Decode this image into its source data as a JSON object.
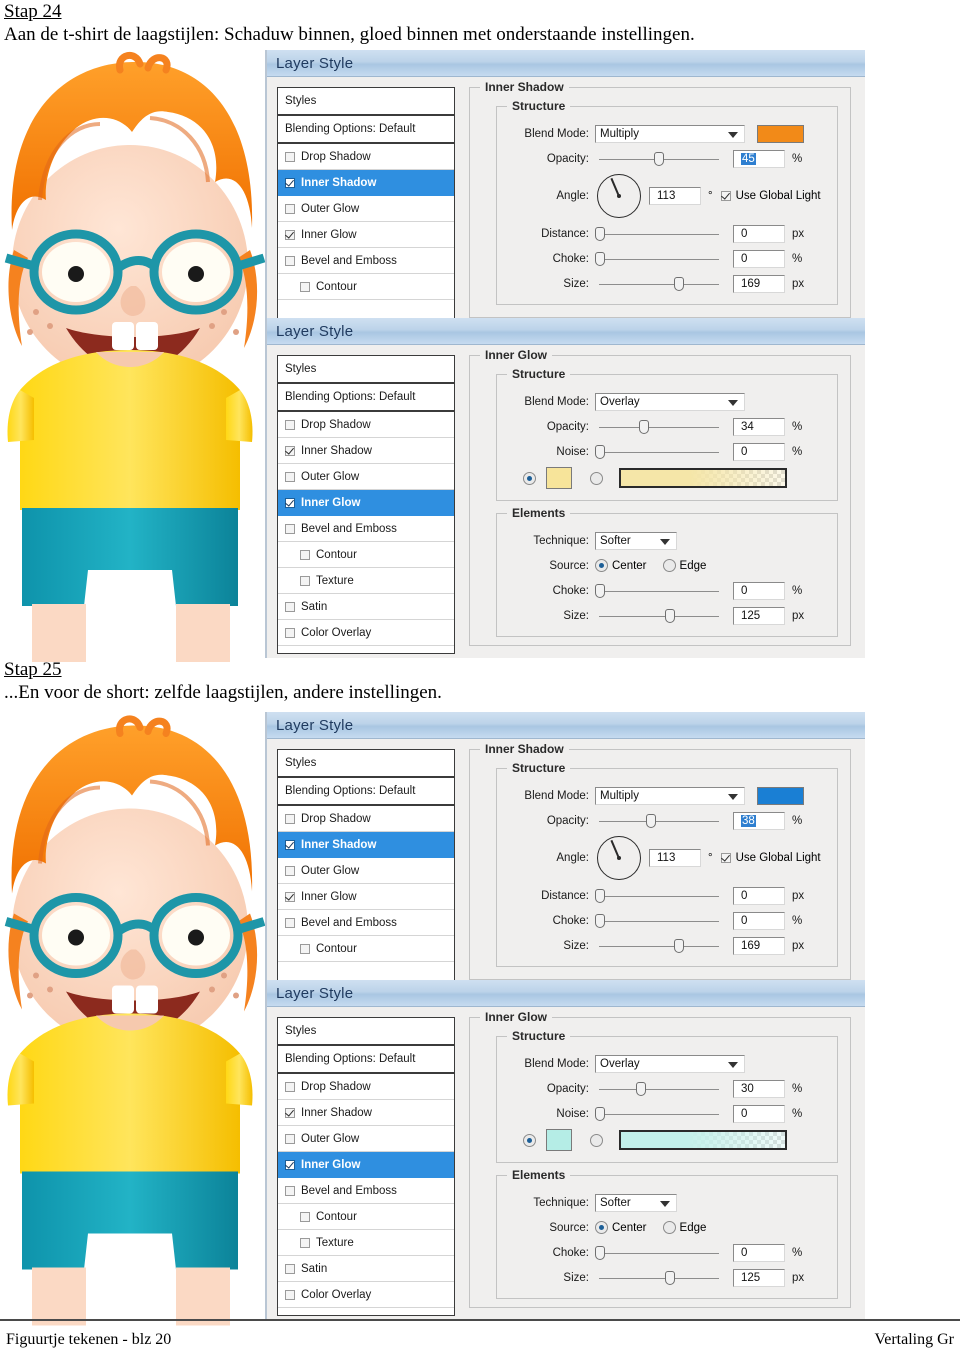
{
  "document": {
    "steps": [
      {
        "heading": "Stap 24",
        "text": "Aan de t-shirt de laagstijlen: Schaduw binnen, gloed binnen met onderstaande instellingen."
      },
      {
        "heading": "Stap 25",
        "text": "...En voor de short: zelfde laagstijlen, andere instellingen."
      }
    ],
    "footer": {
      "left": "Figuurtje tekenen - blz 20",
      "right": "Vertaling Gr"
    }
  },
  "dialog_title": "Layer Style",
  "style_list": {
    "header": "Styles",
    "blending": "Blending Options: Default",
    "items": [
      "Drop Shadow",
      "Inner Shadow",
      "Outer Glow",
      "Inner Glow",
      "Bevel and Emboss",
      "Contour",
      "Texture",
      "Satin",
      "Color Overlay"
    ]
  },
  "labels": {
    "structure": "Structure",
    "elements": "Elements",
    "blend_mode": "Blend Mode:",
    "opacity": "Opacity:",
    "angle": "Angle:",
    "distance": "Distance:",
    "choke": "Choke:",
    "size": "Size:",
    "noise": "Noise:",
    "technique": "Technique:",
    "source": "Source:",
    "center": "Center",
    "edge": "Edge",
    "use_global_light": "Use Global Light",
    "pct": "%",
    "px": "px",
    "deg": "°"
  },
  "dialogs": [
    {
      "id": "tshirt-inner-shadow",
      "section": "Inner Shadow",
      "blend_mode": "Multiply",
      "color": "#F28A18",
      "opacity": "45",
      "opacity_selected": true,
      "angle": "113",
      "use_global_light": true,
      "distance": "0",
      "choke": "0",
      "size": "169",
      "checked": [
        "Inner Shadow",
        "Inner Glow"
      ],
      "selected": "Inner Shadow"
    },
    {
      "id": "tshirt-inner-glow",
      "section": "Inner Glow",
      "blend_mode": "Overlay",
      "opacity": "34",
      "noise": "0",
      "glow_color": "#F7E49A",
      "gradient_color": "#F5E6A8",
      "technique": "Softer",
      "source": "Center",
      "choke": "0",
      "size": "125",
      "checked": [
        "Inner Shadow",
        "Inner Glow"
      ],
      "selected": "Inner Glow"
    },
    {
      "id": "short-inner-shadow",
      "section": "Inner Shadow",
      "blend_mode": "Multiply",
      "color": "#1A7FD4",
      "opacity": "38",
      "opacity_selected": true,
      "angle": "113",
      "use_global_light": true,
      "distance": "0",
      "choke": "0",
      "size": "169",
      "checked": [
        "Inner Shadow",
        "Inner Glow"
      ],
      "selected": "Inner Shadow"
    },
    {
      "id": "short-inner-glow",
      "section": "Inner Glow",
      "blend_mode": "Overlay",
      "opacity": "30",
      "noise": "0",
      "glow_color": "#B5EDE6",
      "gradient_color": "#C3F0EA",
      "technique": "Softer",
      "source": "Center",
      "choke": "0",
      "size": "125",
      "checked": [
        "Inner Shadow",
        "Inner Glow"
      ],
      "selected": "Inner Glow"
    }
  ],
  "illustration": {
    "alt": "cartoon boy with orange hair, teal glasses, yellow t-shirt and teal shorts",
    "colors": {
      "hair": "#F5821F",
      "hair_dark": "#E0661A",
      "skin": "#FBD9C4",
      "glasses": "#1E96A8",
      "shirt": "#FFD215",
      "shorts": "#159BB0",
      "mouth": "#8C2A1E"
    }
  }
}
